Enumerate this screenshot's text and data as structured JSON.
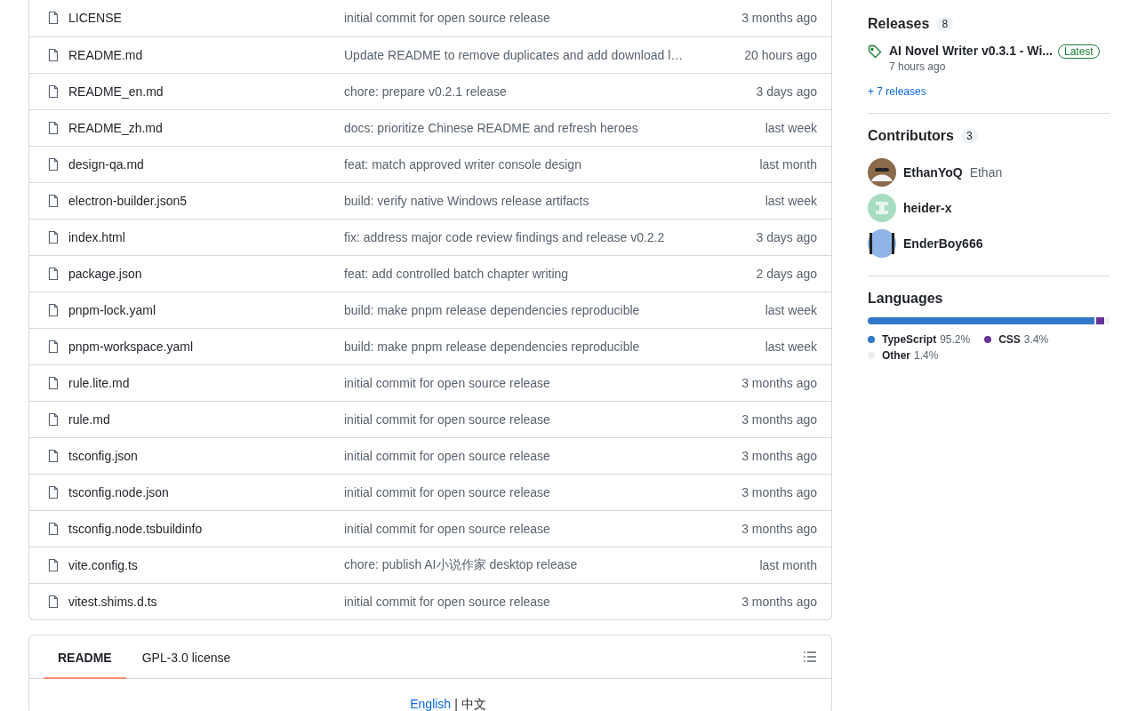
{
  "files": [
    {
      "name": "LICENSE",
      "message": "initial commit for open source release",
      "date": "3 months ago"
    },
    {
      "name": "README.md",
      "message": "Update README to remove duplicates and add download l…",
      "date": "20 hours ago"
    },
    {
      "name": "README_en.md",
      "message": "chore: prepare v0.2.1 release",
      "date": "3 days ago"
    },
    {
      "name": "README_zh.md",
      "message": "docs: prioritize Chinese README and refresh heroes",
      "date": "last week"
    },
    {
      "name": "design-qa.md",
      "message": "feat: match approved writer console design",
      "date": "last month"
    },
    {
      "name": "electron-builder.json5",
      "message": "build: verify native Windows release artifacts",
      "date": "last week"
    },
    {
      "name": "index.html",
      "message": "fix: address major code review findings and release v0.2.2",
      "date": "3 days ago"
    },
    {
      "name": "package.json",
      "message": "feat: add controlled batch chapter writing",
      "date": "2 days ago"
    },
    {
      "name": "pnpm-lock.yaml",
      "message": "build: make pnpm release dependencies reproducible",
      "date": "last week"
    },
    {
      "name": "pnpm-workspace.yaml",
      "message": "build: make pnpm release dependencies reproducible",
      "date": "last week"
    },
    {
      "name": "rule.lite.md",
      "message": "initial commit for open source release",
      "date": "3 months ago"
    },
    {
      "name": "rule.md",
      "message": "initial commit for open source release",
      "date": "3 months ago"
    },
    {
      "name": "tsconfig.json",
      "message": "initial commit for open source release",
      "date": "3 months ago"
    },
    {
      "name": "tsconfig.node.json",
      "message": "initial commit for open source release",
      "date": "3 months ago"
    },
    {
      "name": "tsconfig.node.tsbuildinfo",
      "message": "initial commit for open source release",
      "date": "3 months ago"
    },
    {
      "name": "vite.config.ts",
      "message": "chore: publish AI小说作家 desktop release",
      "date": "last month"
    },
    {
      "name": "vitest.shims.d.ts",
      "message": "initial commit for open source release",
      "date": "3 months ago"
    }
  ],
  "readme": {
    "tabs": [
      {
        "label": "README",
        "selected": true
      },
      {
        "label": "GPL-3.0 license",
        "selected": false
      }
    ],
    "language_link": "English",
    "separator": "|",
    "language_other": "中文"
  },
  "sidebar": {
    "releases": {
      "title": "Releases",
      "count": "8",
      "latest": {
        "name": "AI Novel Writer v0.3.1 - Wi...",
        "badge": "Latest",
        "time": "7 hours ago"
      },
      "more": "+ 7 releases"
    },
    "contributors": {
      "title": "Contributors",
      "count": "3",
      "people": [
        {
          "login": "EthanYoQ",
          "name": "Ethan",
          "color": "#8a6a4a"
        },
        {
          "login": "heider-x",
          "color": "#a8dcc0"
        },
        {
          "login": "EnderBoy666",
          "color": "#8fb4e8"
        }
      ]
    },
    "languages": {
      "title": "Languages",
      "items": [
        {
          "name": "TypeScript",
          "percent": "95.2%",
          "color": "#3178c6"
        },
        {
          "name": "CSS",
          "percent": "3.4%",
          "color": "#663399"
        },
        {
          "name": "Other",
          "percent": "1.4%",
          "color": "#ededed"
        }
      ]
    }
  }
}
